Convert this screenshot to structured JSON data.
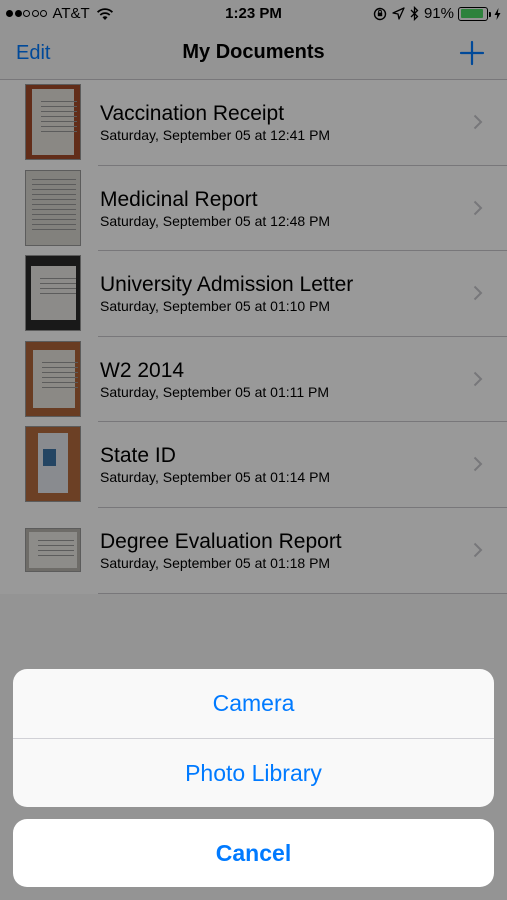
{
  "status_bar": {
    "carrier": "AT&T",
    "time": "1:23 PM",
    "battery_percent": "91%",
    "battery_level": 0.91,
    "signal_bars_filled": 2,
    "signal_bars_total": 5
  },
  "nav": {
    "edit_label": "Edit",
    "title": "My Documents",
    "add_icon": "plus-icon"
  },
  "documents": [
    {
      "name": "Vaccination Receipt",
      "date": "Saturday, September 05 at 12:41 PM"
    },
    {
      "name": "Medicinal Report",
      "date": "Saturday, September 05 at 12:48 PM"
    },
    {
      "name": "University Admission Letter",
      "date": "Saturday, September 05 at 01:10 PM"
    },
    {
      "name": "W2 2014",
      "date": "Saturday, September 05 at 01:11 PM"
    },
    {
      "name": "State ID",
      "date": "Saturday, September 05 at 01:14 PM"
    },
    {
      "name": "Degree Evaluation Report",
      "date": "Saturday, September 05 at 01:18 PM"
    }
  ],
  "action_sheet": {
    "options": [
      {
        "label": "Camera"
      },
      {
        "label": "Photo Library"
      }
    ],
    "cancel_label": "Cancel"
  },
  "colors": {
    "accent": "#007aff",
    "battery": "#4cd964"
  }
}
